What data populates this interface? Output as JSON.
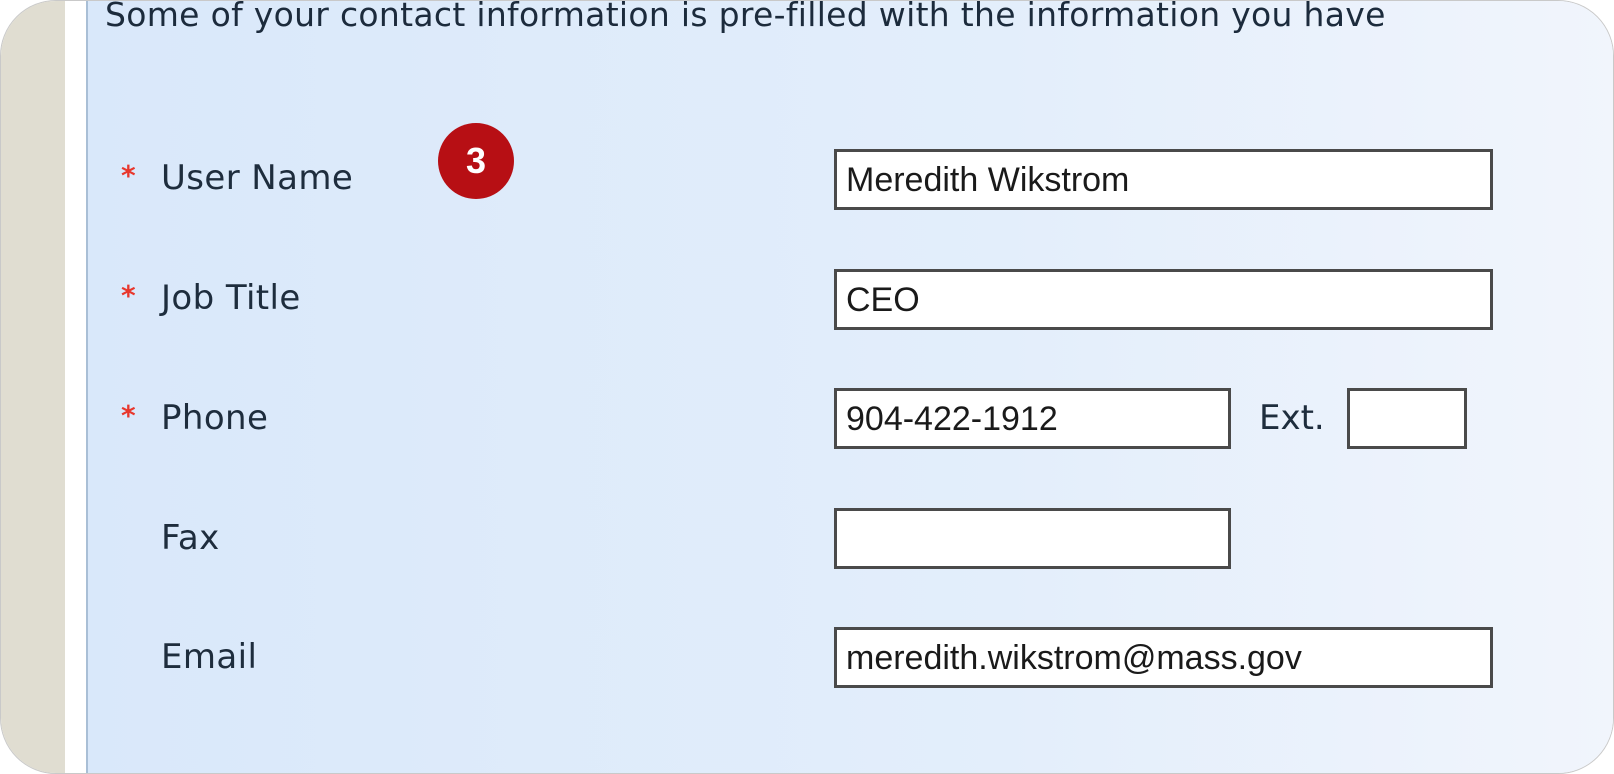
{
  "intro_text": "Some of your contact information is pre-filled with the information you have",
  "required_marker": "*",
  "step_badge": "3",
  "fields": {
    "user_name": {
      "label": "User Name",
      "value": "Meredith Wikstrom",
      "required": true
    },
    "job_title": {
      "label": "Job Title",
      "value": "CEO",
      "required": true
    },
    "phone": {
      "label": "Phone",
      "value": "904-422-1912",
      "required": true,
      "ext_label": "Ext.",
      "ext_value": ""
    },
    "fax": {
      "label": "Fax",
      "value": "",
      "required": false
    },
    "email": {
      "label": "Email",
      "value": "meredith.wikstrom@mass.gov",
      "required": false
    }
  },
  "colors": {
    "required_marker": "#e8372c",
    "badge": "#b70f14",
    "panel": "#d9e8fa"
  }
}
